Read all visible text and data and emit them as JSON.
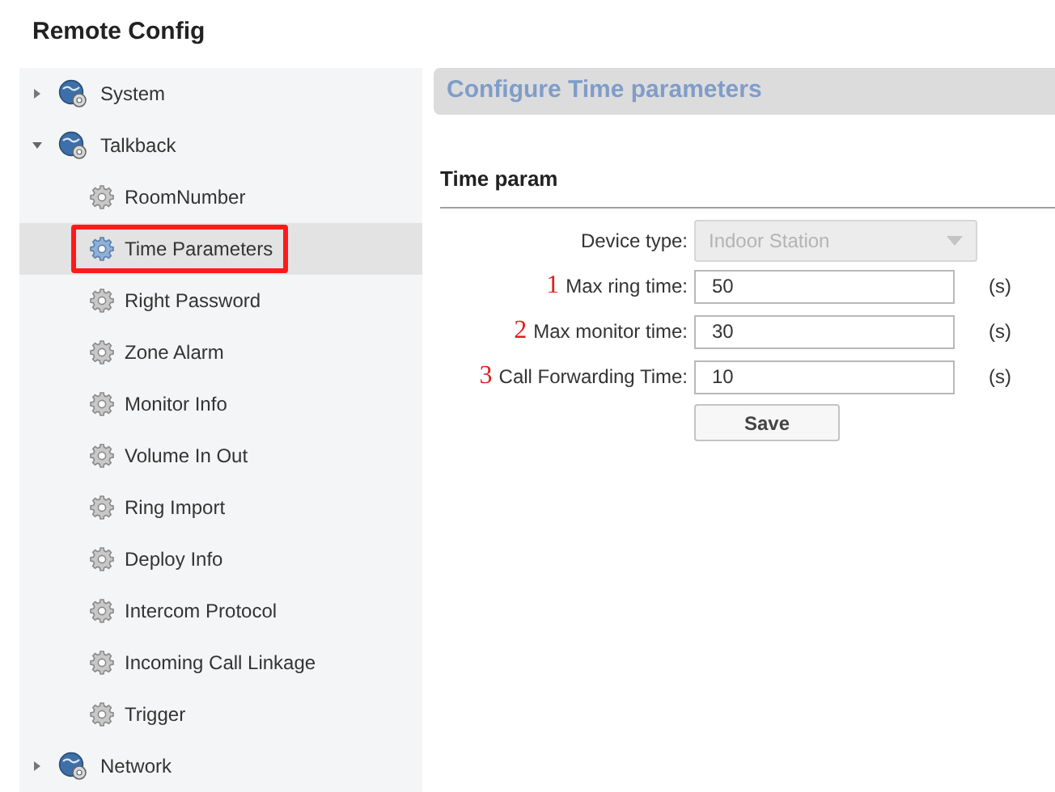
{
  "page_title": "Remote Config",
  "tree": [
    {
      "label": "System",
      "expanded": false
    },
    {
      "label": "Talkback",
      "expanded": true,
      "children": [
        {
          "label": "RoomNumber",
          "selected": false
        },
        {
          "label": "Time Parameters",
          "selected": true
        },
        {
          "label": "Right Password",
          "selected": false
        },
        {
          "label": "Zone Alarm",
          "selected": false
        },
        {
          "label": "Monitor Info",
          "selected": false
        },
        {
          "label": "Volume In Out",
          "selected": false
        },
        {
          "label": "Ring Import",
          "selected": false
        },
        {
          "label": "Deploy Info",
          "selected": false
        },
        {
          "label": "Intercom Protocol",
          "selected": false
        },
        {
          "label": "Incoming Call Linkage",
          "selected": false
        },
        {
          "label": "Trigger",
          "selected": false
        }
      ]
    },
    {
      "label": "Network",
      "expanded": false
    }
  ],
  "panel": {
    "header": "Configure Time parameters",
    "section": "Time param",
    "fields": [
      {
        "kind": "select",
        "label": "Device type:",
        "value": "Indoor Station",
        "disabled": true
      },
      {
        "kind": "input",
        "marker": "1",
        "label": "Max ring time:",
        "value": "50",
        "unit": "(s)"
      },
      {
        "kind": "input",
        "marker": "2",
        "label": "Max monitor time:",
        "value": "30",
        "unit": "(s)"
      },
      {
        "kind": "input",
        "marker": "3",
        "label": "Call Forwarding Time:",
        "value": "10",
        "unit": "(s)"
      }
    ],
    "save_button": "Save"
  }
}
